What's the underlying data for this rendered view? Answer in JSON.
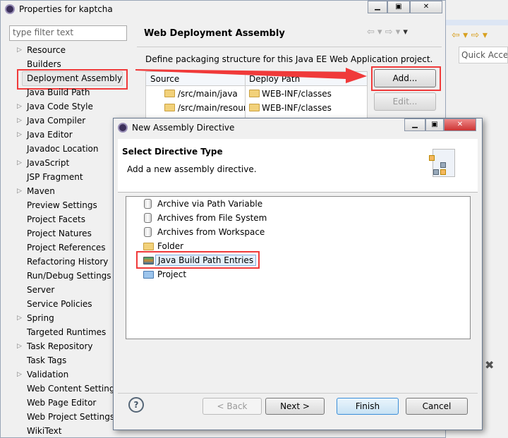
{
  "outer": {
    "title": "Properties for kaptcha",
    "filter_placeholder": "type filter text",
    "tree": [
      {
        "label": "Resource",
        "exp": true
      },
      {
        "label": "Builders"
      },
      {
        "label": "Deployment Assembly",
        "selected": true
      },
      {
        "label": "Java Build Path"
      },
      {
        "label": "Java Code Style",
        "exp": true
      },
      {
        "label": "Java Compiler",
        "exp": true
      },
      {
        "label": "Java Editor",
        "exp": true
      },
      {
        "label": "Javadoc Location"
      },
      {
        "label": "JavaScript",
        "exp": true
      },
      {
        "label": "JSP Fragment"
      },
      {
        "label": "Maven",
        "exp": true
      },
      {
        "label": "Preview Settings"
      },
      {
        "label": "Project Facets"
      },
      {
        "label": "Project Natures"
      },
      {
        "label": "Project References"
      },
      {
        "label": "Refactoring History"
      },
      {
        "label": "Run/Debug Settings"
      },
      {
        "label": "Server"
      },
      {
        "label": "Service Policies"
      },
      {
        "label": "Spring",
        "exp": true
      },
      {
        "label": "Targeted Runtimes"
      },
      {
        "label": "Task Repository",
        "exp": true
      },
      {
        "label": "Task Tags"
      },
      {
        "label": "Validation",
        "exp": true
      },
      {
        "label": "Web Content Settings"
      },
      {
        "label": "Web Page Editor"
      },
      {
        "label": "Web Project Settings"
      },
      {
        "label": "WikiText"
      }
    ],
    "page_title": "Web Deployment Assembly",
    "description": "Define packaging structure for this Java EE Web Application project.",
    "columns": [
      "Source",
      "Deploy Path"
    ],
    "rows": [
      [
        "/src/main/java",
        "WEB-INF/classes"
      ],
      [
        "/src/main/resour",
        "WEB-INF/classes"
      ]
    ],
    "add_label": "Add...",
    "edit_label": "Edit..."
  },
  "ide": {
    "quick_access": "Quick Acces"
  },
  "dialog": {
    "title": "New Assembly Directive",
    "heading": "Select Directive Type",
    "subheading": "Add a new assembly directive.",
    "items": [
      {
        "label": "Archive via Path Variable",
        "icon": "jar"
      },
      {
        "label": "Archives from File System",
        "icon": "jar"
      },
      {
        "label": "Archives from Workspace",
        "icon": "jar"
      },
      {
        "label": "Folder",
        "icon": "folder"
      },
      {
        "label": "Java Build Path Entries",
        "icon": "library",
        "selected": true
      },
      {
        "label": "Project",
        "icon": "project"
      }
    ],
    "back": "< Back",
    "next": "Next >",
    "finish": "Finish",
    "cancel": "Cancel"
  },
  "accent": "#f03a3a"
}
